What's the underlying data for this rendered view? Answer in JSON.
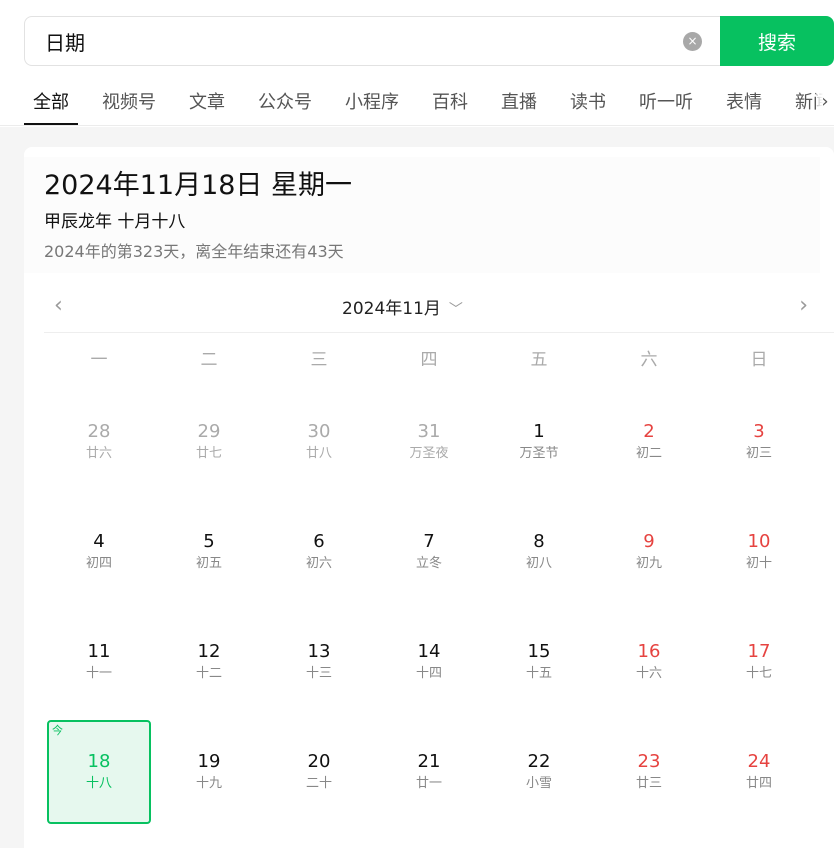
{
  "search": {
    "value": "日期",
    "clear_label": "×",
    "button_label": "搜索"
  },
  "tabs": [
    "全部",
    "视频号",
    "文章",
    "公众号",
    "小程序",
    "百科",
    "直播",
    "读书",
    "听一听",
    "表情",
    "新闻"
  ],
  "tab_more": "›",
  "info": {
    "date_title": "2024年11月18日 星期一",
    "lunar": "甲辰龙年 十月十八",
    "day_count": "2024年的第323天，离全年结束还有43天"
  },
  "month_bar": {
    "prev": "‹",
    "label": "2024年11月",
    "dropdown": "﹀",
    "next": "›"
  },
  "weekdays": [
    "一",
    "二",
    "三",
    "四",
    "五",
    "六",
    "日"
  ],
  "today_tag": "今",
  "days": [
    {
      "d": "28",
      "l": "廿六",
      "other": true
    },
    {
      "d": "29",
      "l": "廿七",
      "other": true
    },
    {
      "d": "30",
      "l": "廿八",
      "other": true
    },
    {
      "d": "31",
      "l": "万圣夜",
      "other": true
    },
    {
      "d": "1",
      "l": "万圣节"
    },
    {
      "d": "2",
      "l": "初二"
    },
    {
      "d": "3",
      "l": "初三"
    },
    {
      "d": "4",
      "l": "初四"
    },
    {
      "d": "5",
      "l": "初五"
    },
    {
      "d": "6",
      "l": "初六"
    },
    {
      "d": "7",
      "l": "立冬"
    },
    {
      "d": "8",
      "l": "初八"
    },
    {
      "d": "9",
      "l": "初九"
    },
    {
      "d": "10",
      "l": "初十"
    },
    {
      "d": "11",
      "l": "十一"
    },
    {
      "d": "12",
      "l": "十二"
    },
    {
      "d": "13",
      "l": "十三"
    },
    {
      "d": "14",
      "l": "十四"
    },
    {
      "d": "15",
      "l": "十五"
    },
    {
      "d": "16",
      "l": "十六"
    },
    {
      "d": "17",
      "l": "十七"
    },
    {
      "d": "18",
      "l": "十八",
      "today": true
    },
    {
      "d": "19",
      "l": "十九"
    },
    {
      "d": "20",
      "l": "二十"
    },
    {
      "d": "21",
      "l": "廿一"
    },
    {
      "d": "22",
      "l": "小雪"
    },
    {
      "d": "23",
      "l": "廿三"
    },
    {
      "d": "24",
      "l": "廿四"
    }
  ],
  "colors": {
    "accent": "#07c160",
    "weekend": "#e64340",
    "today_bg": "#e6f8ee"
  }
}
